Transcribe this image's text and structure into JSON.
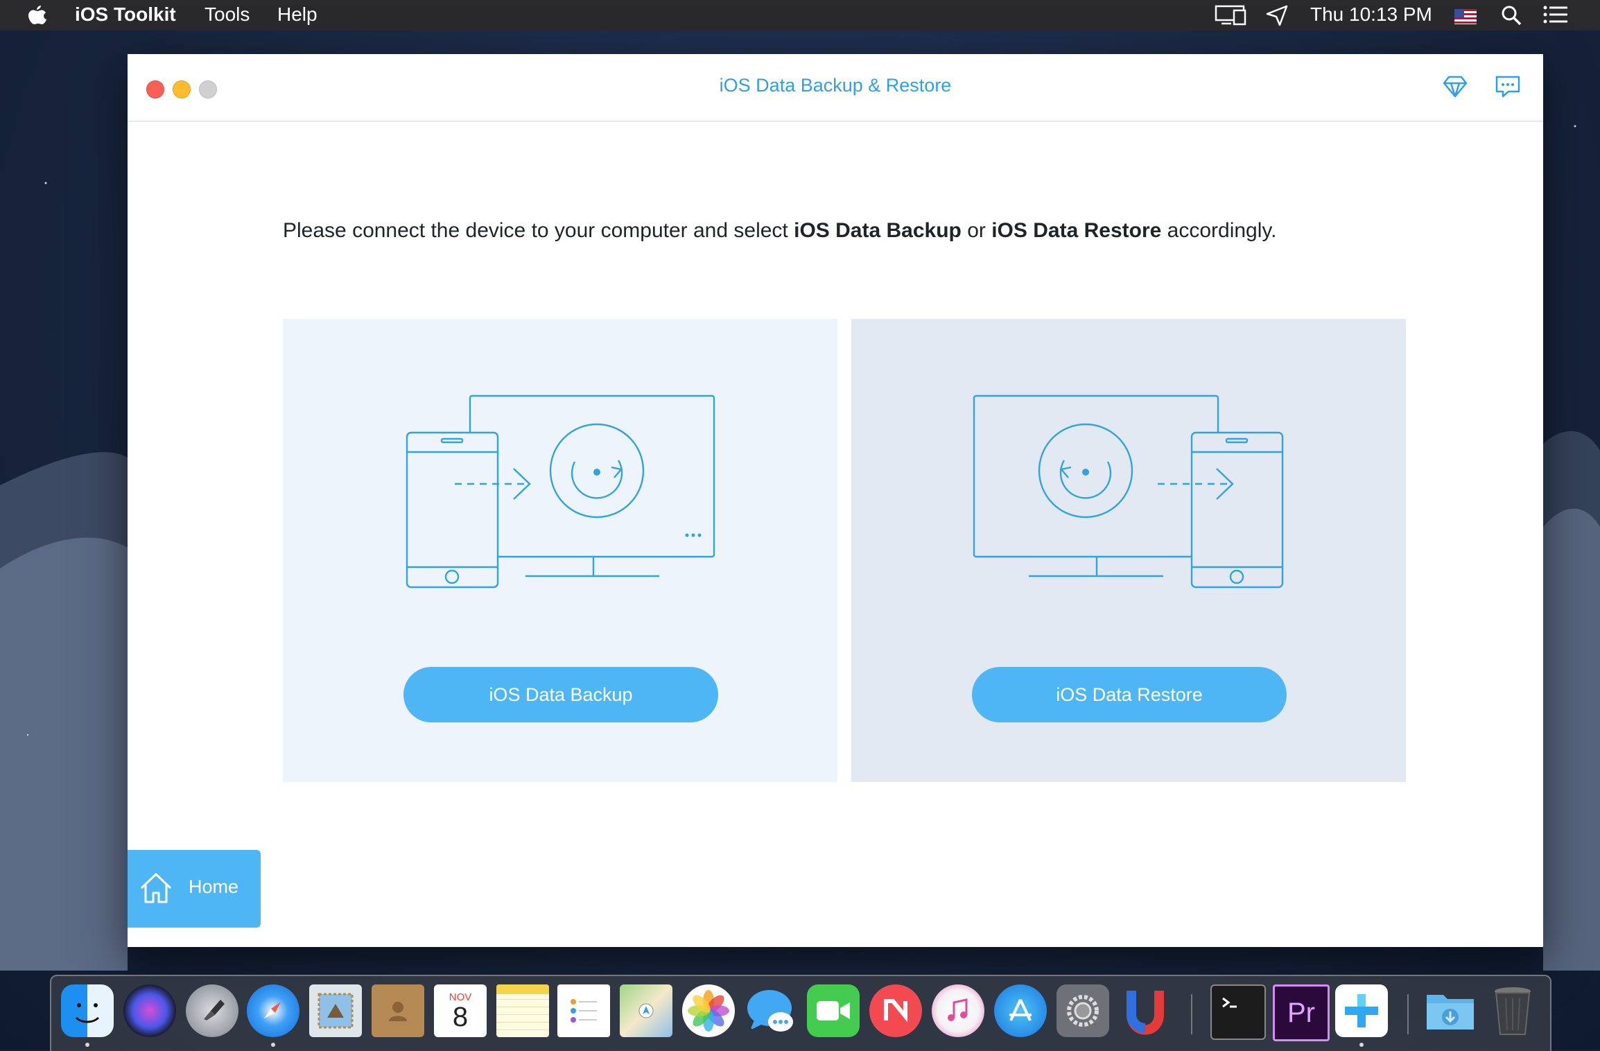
{
  "menubar": {
    "app_name": "iOS Toolkit",
    "menus": [
      "Tools",
      "Help"
    ],
    "clock": "Thu 10:13 PM",
    "status_icons": [
      "display-mirroring-icon",
      "location-send-icon",
      "us-flag-icon",
      "spotlight-search-icon",
      "notification-list-icon"
    ]
  },
  "window": {
    "title": "iOS Data Backup & Restore",
    "toolbar_icons": [
      "diamond-icon",
      "feedback-chat-icon"
    ],
    "instruction": {
      "part1": "Please connect the device to your computer and select ",
      "bold1": "iOS Data Backup",
      "part2": " or ",
      "bold2": "iOS Data Restore",
      "part3": " accordingly."
    },
    "cards": {
      "backup": {
        "button": "iOS Data Backup"
      },
      "restore": {
        "button": "iOS Data Restore"
      }
    },
    "home": {
      "label": "Home"
    }
  },
  "dock": {
    "apps": [
      "Finder",
      "Siri",
      "Launchpad",
      "Safari",
      "Mail",
      "Contacts",
      "Calendar",
      "Notes",
      "Reminders",
      "Maps",
      "Photos",
      "Messages",
      "FaceTime",
      "News",
      "iTunes",
      "App Store",
      "System Preferences",
      "Magnet",
      "Terminal",
      "Premiere Pro",
      "iOS Toolkit",
      "Downloads",
      "Trash"
    ],
    "calendar": {
      "month": "NOV",
      "day": "8"
    },
    "premiere_label": "Pr"
  },
  "colors": {
    "accent": "#4fb6f6",
    "title_blue": "#2f9fe8",
    "card_backup_bg": "#eef4fc",
    "card_restore_bg": "#e2e9f3"
  }
}
